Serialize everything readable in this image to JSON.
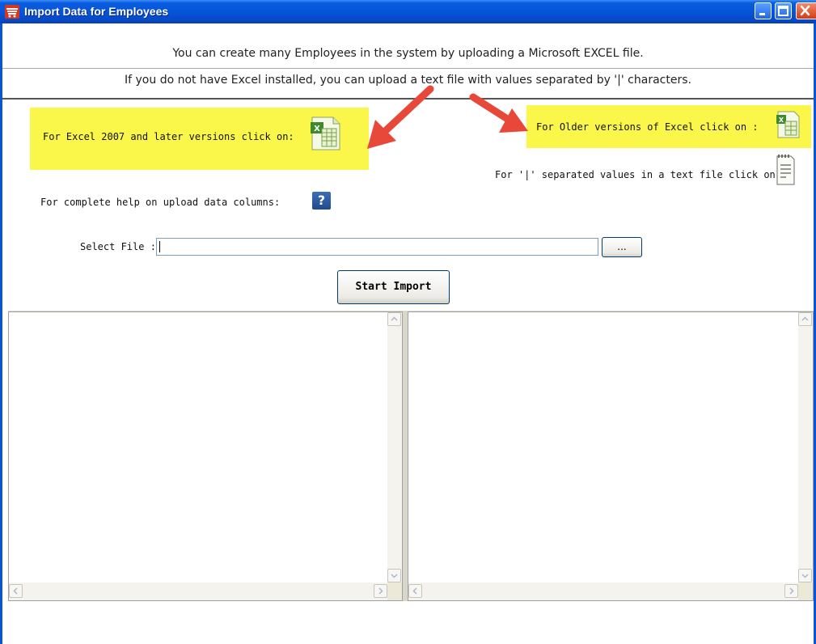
{
  "window": {
    "title": "Import Data for Employees"
  },
  "info": {
    "line1": "You can create many Employees in the system by uploading a Microsoft EXCEL  file.",
    "line2": "If you do not have Excel installed, you can upload a text file with values separated by '|' characters."
  },
  "options": {
    "excel2007_label": "For Excel 2007 and later versions click on:",
    "older_excel_label": "For Older versions of Excel click on :",
    "text_file_label": "For '|' separated  values in a text file click on :",
    "help_label": "For complete help on upload data columns:",
    "help_icon_glyph": "?"
  },
  "file": {
    "select_label": "Select File :",
    "value": "",
    "browse_label": "...",
    "start_import_label": "Start Import"
  },
  "colors": {
    "highlight": "#fbf74a",
    "arrow": "#e8483a",
    "titlebar": "#0553d8"
  },
  "icons": {
    "app": "cart-icon",
    "excel2007": "excel-xlsx-icon",
    "excel_old": "excel-xls-icon",
    "text": "text-file-icon",
    "help": "help-icon"
  }
}
